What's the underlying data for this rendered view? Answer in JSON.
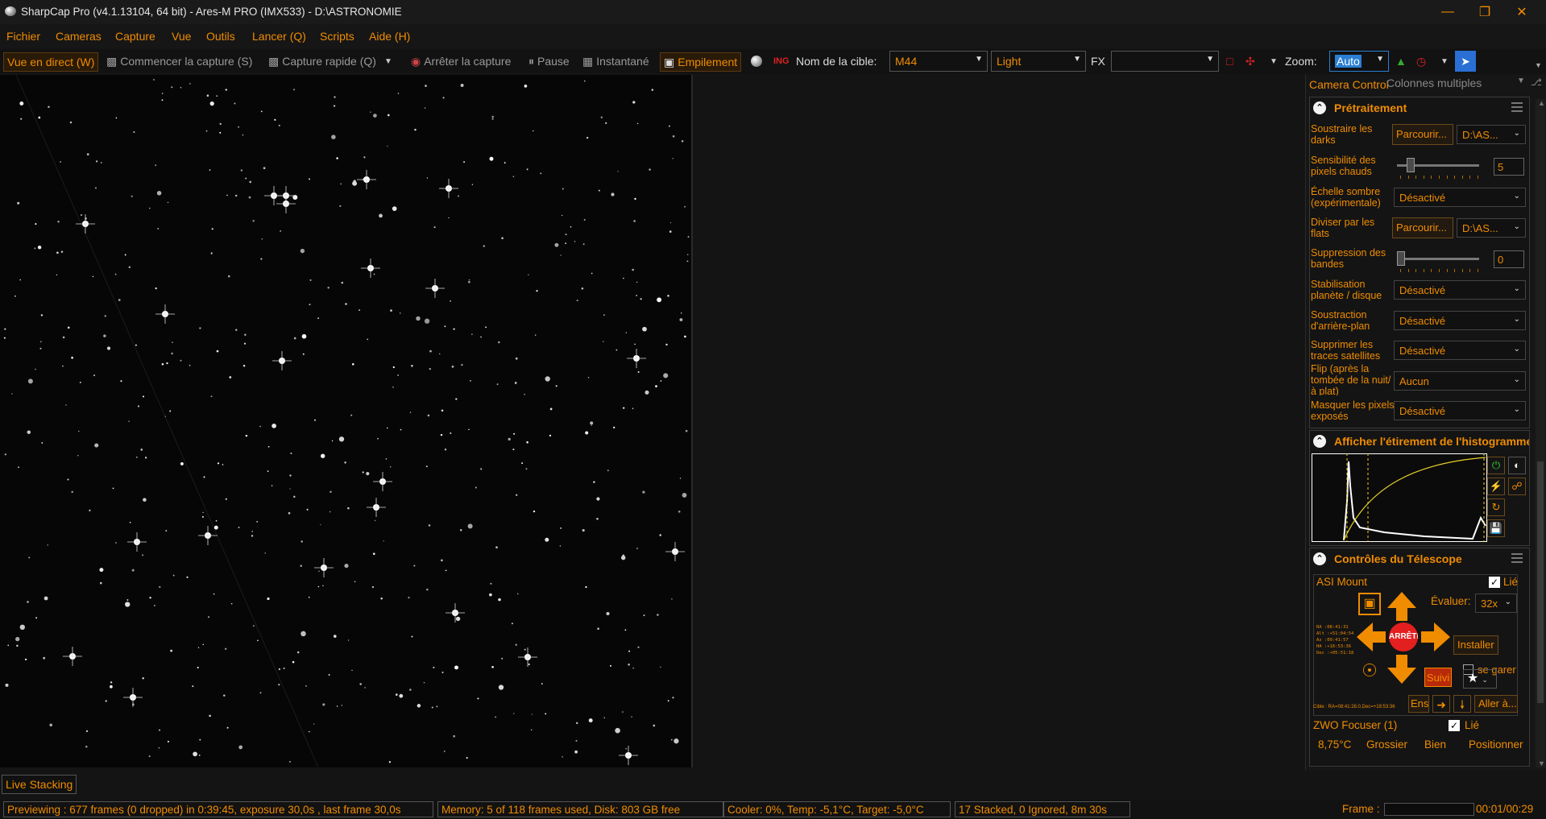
{
  "window": {
    "title": "SharpCap Pro (v4.1.13104, 64 bit) - Ares-M PRO (IMX533) - D:\\ASTRONOMIE",
    "minimize_icon": "minimize-icon",
    "maximize_icon": "restore-icon",
    "close_icon": "close-icon"
  },
  "menu": [
    "Fichier",
    "Cameras",
    "Capture",
    "Vue",
    "Outils",
    "Lancer (Q)",
    "Scripts",
    "Aide (H)"
  ],
  "toolbar": {
    "live_view": "Vue en direct (W)",
    "start_capture": "Commencer la capture (S)",
    "quick_capture": "Capture rapide (Q)",
    "stop_capture": "Arrêter la capture",
    "pause": "Pause",
    "snapshot": "Instantané",
    "stacking": "Empilement",
    "target_label": "Nom de la cible:",
    "target_value": "M44",
    "frame_type": "Light",
    "fx_label": "FX",
    "fx_value": "",
    "zoom_label": "Zoom:",
    "zoom_value": "Auto"
  },
  "side_tabs": {
    "camera_control": "Camera Control",
    "multi_columns": "Colonnes multiples"
  },
  "preprocessing": {
    "title": "Prétraitement",
    "rows": {
      "dark_label": "Soustraire les darks",
      "dark_browse": "Parcourir...",
      "dark_path": "D:\\AS...",
      "hot_label": "Sensibilité des pixels chauds",
      "hot_value": "5",
      "hot_fraction": 0.12,
      "dark_scale_label": "Échelle sombre (expérimentale)",
      "dark_scale_value": "Désactivé",
      "flat_label": "Diviser par les flats",
      "flat_browse": "Parcourir...",
      "flat_path": "D:\\AS...",
      "banding_label": "Suppression des bandes",
      "banding_value": "0",
      "banding_fraction": 0.0,
      "stab_label": "Stabilisation planète / disque",
      "stab_value": "Désactivé",
      "bg_label": "Soustraction d'arrière-plan",
      "bg_value": "Désactivé",
      "sat_label": "Supprimer les traces satellites",
      "sat_value": "Désactivé",
      "flip_label": "Flip (après la tombée de la nuit/à plat)",
      "flip_value": "Aucun",
      "mask_label": "Masquer les pixels exposés",
      "mask_value": "Désactivé"
    }
  },
  "histogram": {
    "title": "Afficher l'étirement de l'histogramme"
  },
  "telescope": {
    "title": "Contrôles du Télescope",
    "mount_name": "ASI Mount",
    "linked_label": "Lié",
    "linked": true,
    "rate_label": "Évaluer:",
    "rate_value": "32x",
    "install_button": "Installer",
    "stop_button": "ARRÊTER",
    "park_label": "se garer",
    "tracking_button": "Suivi",
    "ens_button": "Ens",
    "goto_button": "Aller à...",
    "target_line": "Cible : RA=08:41:28.0,Dec=+19:53:36",
    "readout": [
      "RA  :08:41:31",
      "Alt :+51:04:54",
      "Az  :09:41:57",
      "HA  :+16:53:36",
      "Dec :+05:51:18"
    ]
  },
  "focuser": {
    "name": "ZWO Focuser (1)",
    "linked_label": "Lié",
    "linked": true,
    "temp": "8,75°C",
    "coarse": "Grossier",
    "fine": "Bien",
    "position": "Positionner"
  },
  "bottom": {
    "live_stacking": "Live Stacking"
  },
  "status": {
    "previewing": "Previewing : 677 frames (0 dropped) in 0:39:45, exposure 30,0s , last frame 30,0s",
    "memory": "Memory: 5 of 118 frames used, Disk: 803 GB free",
    "cooler": "Cooler: 0%, Temp: -5,1°C, Target: -5,0°C",
    "stacked": "17 Stacked, 0 Ignored, 8m 30s",
    "frame_label": "Frame :",
    "frame_time": "00:01/00:29"
  },
  "colors": {
    "accent": "#f08c00",
    "background": "#141414"
  }
}
